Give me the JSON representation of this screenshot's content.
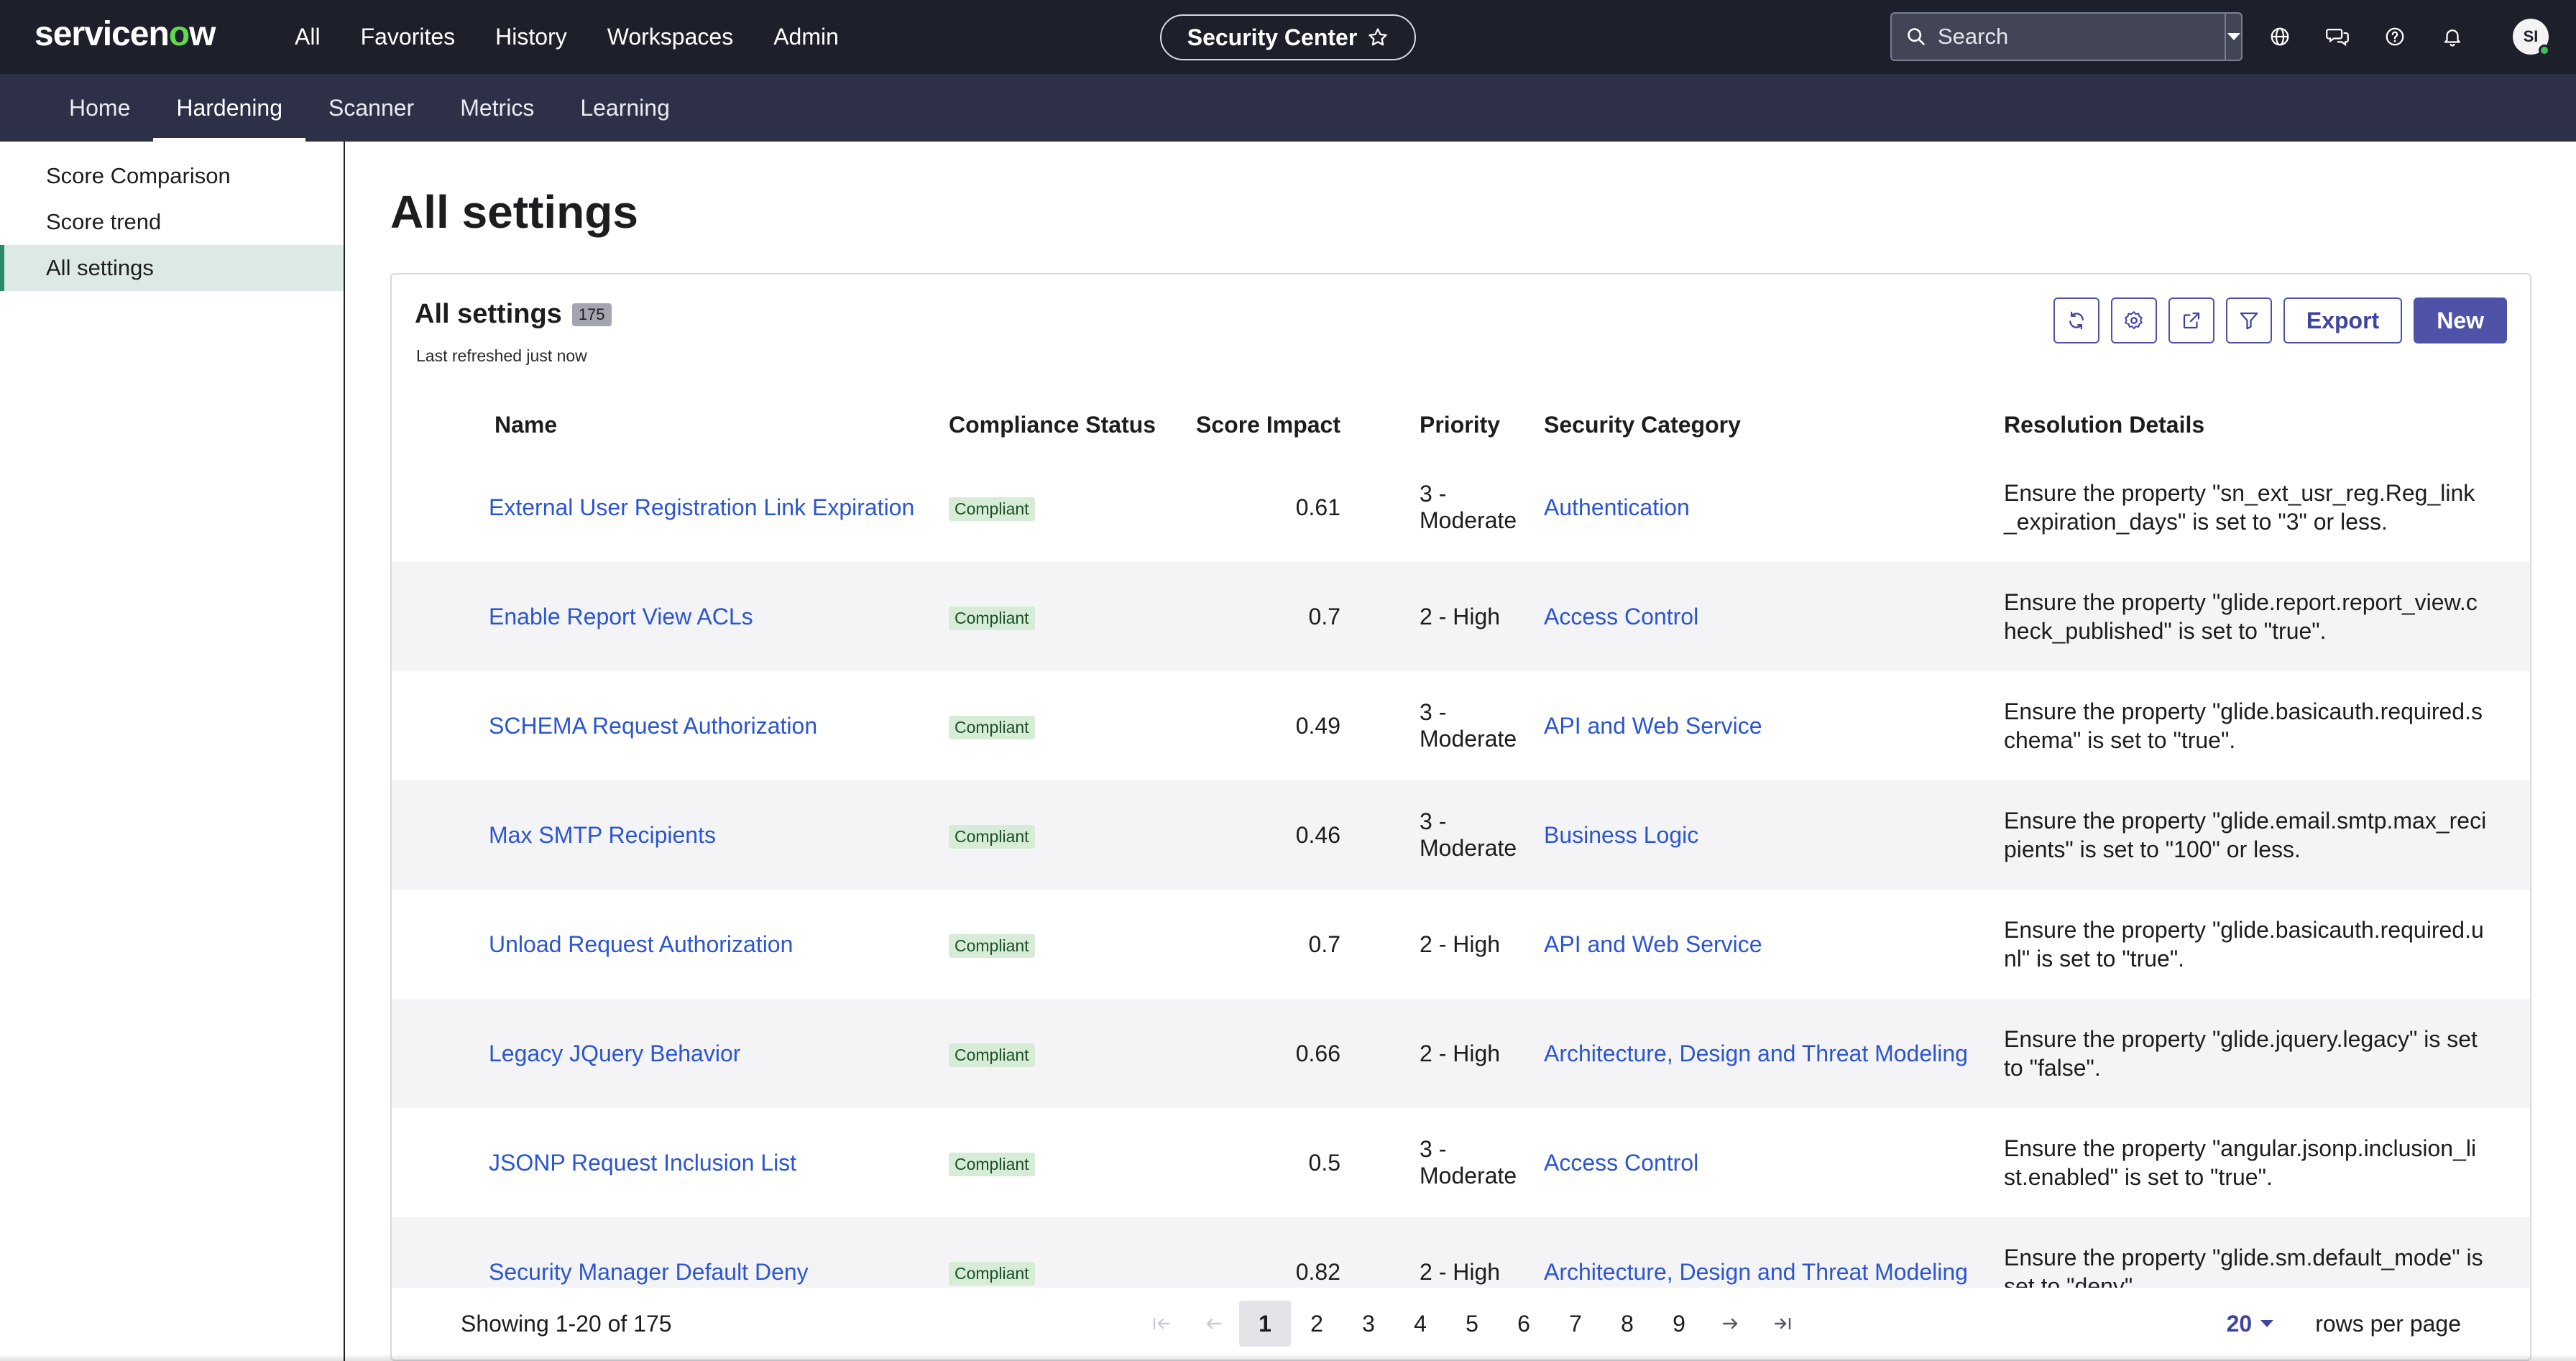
{
  "brand": {
    "logo_prefix": "servicen",
    "logo_o": "o",
    "logo_suffix": "w",
    "accent": "#62d84e"
  },
  "topnav": {
    "items": [
      "All",
      "Favorites",
      "History",
      "Workspaces",
      "Admin"
    ]
  },
  "workspace_pill": {
    "label": "Security Center",
    "icon": "star-icon"
  },
  "search": {
    "placeholder": "Search"
  },
  "top_icons": [
    "globe-icon",
    "chat-icon",
    "help-icon",
    "bell-icon"
  ],
  "user": {
    "initials": "SI",
    "status_color": "#3ec150"
  },
  "subnav": {
    "tabs": [
      "Home",
      "Hardening",
      "Scanner",
      "Metrics",
      "Learning"
    ],
    "active": "Hardening"
  },
  "sidebar": {
    "items": [
      "Score Comparison",
      "Score trend",
      "All settings"
    ],
    "active": "All settings"
  },
  "page": {
    "title": "All settings"
  },
  "list": {
    "title": "All settings",
    "count": "175",
    "refreshed": "Last refreshed just now",
    "toolbar": {
      "icons": [
        "refresh-icon",
        "settings-icon",
        "share-icon",
        "filter-icon"
      ],
      "export_label": "Export",
      "new_label": "New"
    },
    "columns": [
      "Name",
      "Compliance Status",
      "Score Impact",
      "Priority",
      "Security Category",
      "Resolution Details"
    ],
    "rows": [
      {
        "name": "External User Registration Link Expiration",
        "status": "Compliant",
        "score": "0.61",
        "priority": "3 - Moderate",
        "category": "Authentication",
        "resolution": "Ensure the property \"sn_ext_usr_reg.Reg_link_expiration_days\" is set to \"3\" or less."
      },
      {
        "name": "Enable Report View ACLs",
        "status": "Compliant",
        "score": "0.7",
        "priority": "2 - High",
        "category": "Access Control",
        "resolution": "Ensure the property \"glide.report.report_view.check_published\" is set to \"true\"."
      },
      {
        "name": "SCHEMA Request Authorization",
        "status": "Compliant",
        "score": "0.49",
        "priority": "3 - Moderate",
        "category": "API and Web Service",
        "resolution": "Ensure the property \"glide.basicauth.required.schema\" is set to \"true\"."
      },
      {
        "name": "Max SMTP Recipients",
        "status": "Compliant",
        "score": "0.46",
        "priority": "3 - Moderate",
        "category": "Business Logic",
        "resolution": "Ensure the property \"glide.email.smtp.max_recipients\" is set to \"100\" or less."
      },
      {
        "name": "Unload Request Authorization",
        "status": "Compliant",
        "score": "0.7",
        "priority": "2 - High",
        "category": "API and Web Service",
        "resolution": "Ensure the property \"glide.basicauth.required.unl\" is set to \"true\"."
      },
      {
        "name": "Legacy JQuery Behavior",
        "status": "Compliant",
        "score": "0.66",
        "priority": "2 - High",
        "category": "Architecture, Design and Threat Modeling",
        "resolution": "Ensure the property \"glide.jquery.legacy\" is set to \"false\"."
      },
      {
        "name": "JSONP Request Inclusion List",
        "status": "Compliant",
        "score": "0.5",
        "priority": "3 - Moderate",
        "category": "Access Control",
        "resolution": "Ensure the property \"angular.jsonp.inclusion_list.enabled\" is set to \"true\"."
      },
      {
        "name": "Security Manager Default Deny",
        "status": "Compliant",
        "score": "0.82",
        "priority": "2 - High",
        "category": "Architecture, Design and Threat Modeling",
        "resolution": "Ensure the property \"glide.sm.default_mode\" is set to \"deny\"."
      }
    ]
  },
  "pagination": {
    "showing": "Showing 1-20 of 175",
    "pages": [
      "1",
      "2",
      "3",
      "4",
      "5",
      "6",
      "7",
      "8",
      "9"
    ],
    "current": "1",
    "rows_value": "20",
    "rows_label": "rows per page"
  }
}
